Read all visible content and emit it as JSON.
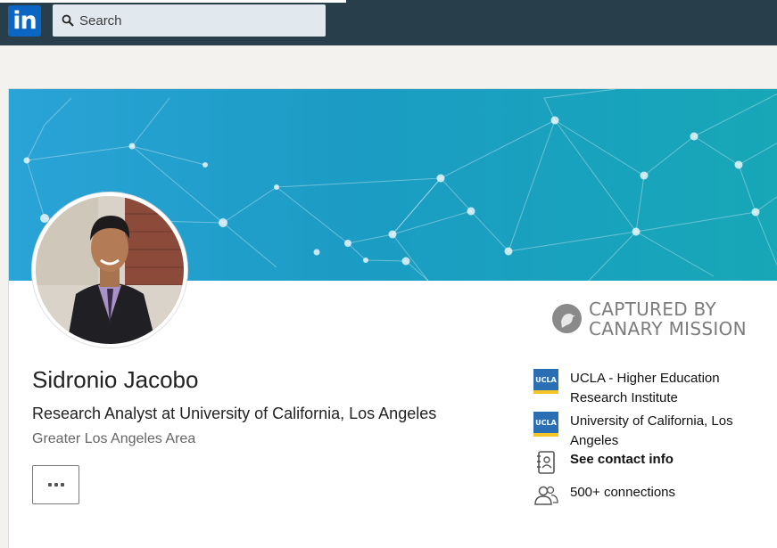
{
  "nav": {
    "logo_text": "in",
    "search_placeholder": "Search"
  },
  "profile": {
    "name": "Sidronio Jacobo",
    "headline": "Research Analyst at University of California, Los Angeles",
    "location": "Greater Los Angeles Area",
    "more_icon": "ellipsis-icon"
  },
  "watermark": {
    "line1": "CAPTURED BY",
    "line2": "CANARY MISSION"
  },
  "sidebar": {
    "items": [
      {
        "icon": "ucla-logo",
        "icon_text": "UCLA",
        "label": "UCLA - Higher Education Research Institute"
      },
      {
        "icon": "ucla-logo",
        "icon_text": "UCLA",
        "label": "University of California, Los Angeles"
      },
      {
        "icon": "contact-card-icon",
        "label": "See contact info"
      },
      {
        "icon": "people-icon",
        "label": "500+ connections"
      }
    ]
  },
  "colors": {
    "nav_bg": "#283e4a",
    "brand": "#0a66c2",
    "banner_start": "#2aa3d6",
    "banner_end": "#17a7b7"
  }
}
